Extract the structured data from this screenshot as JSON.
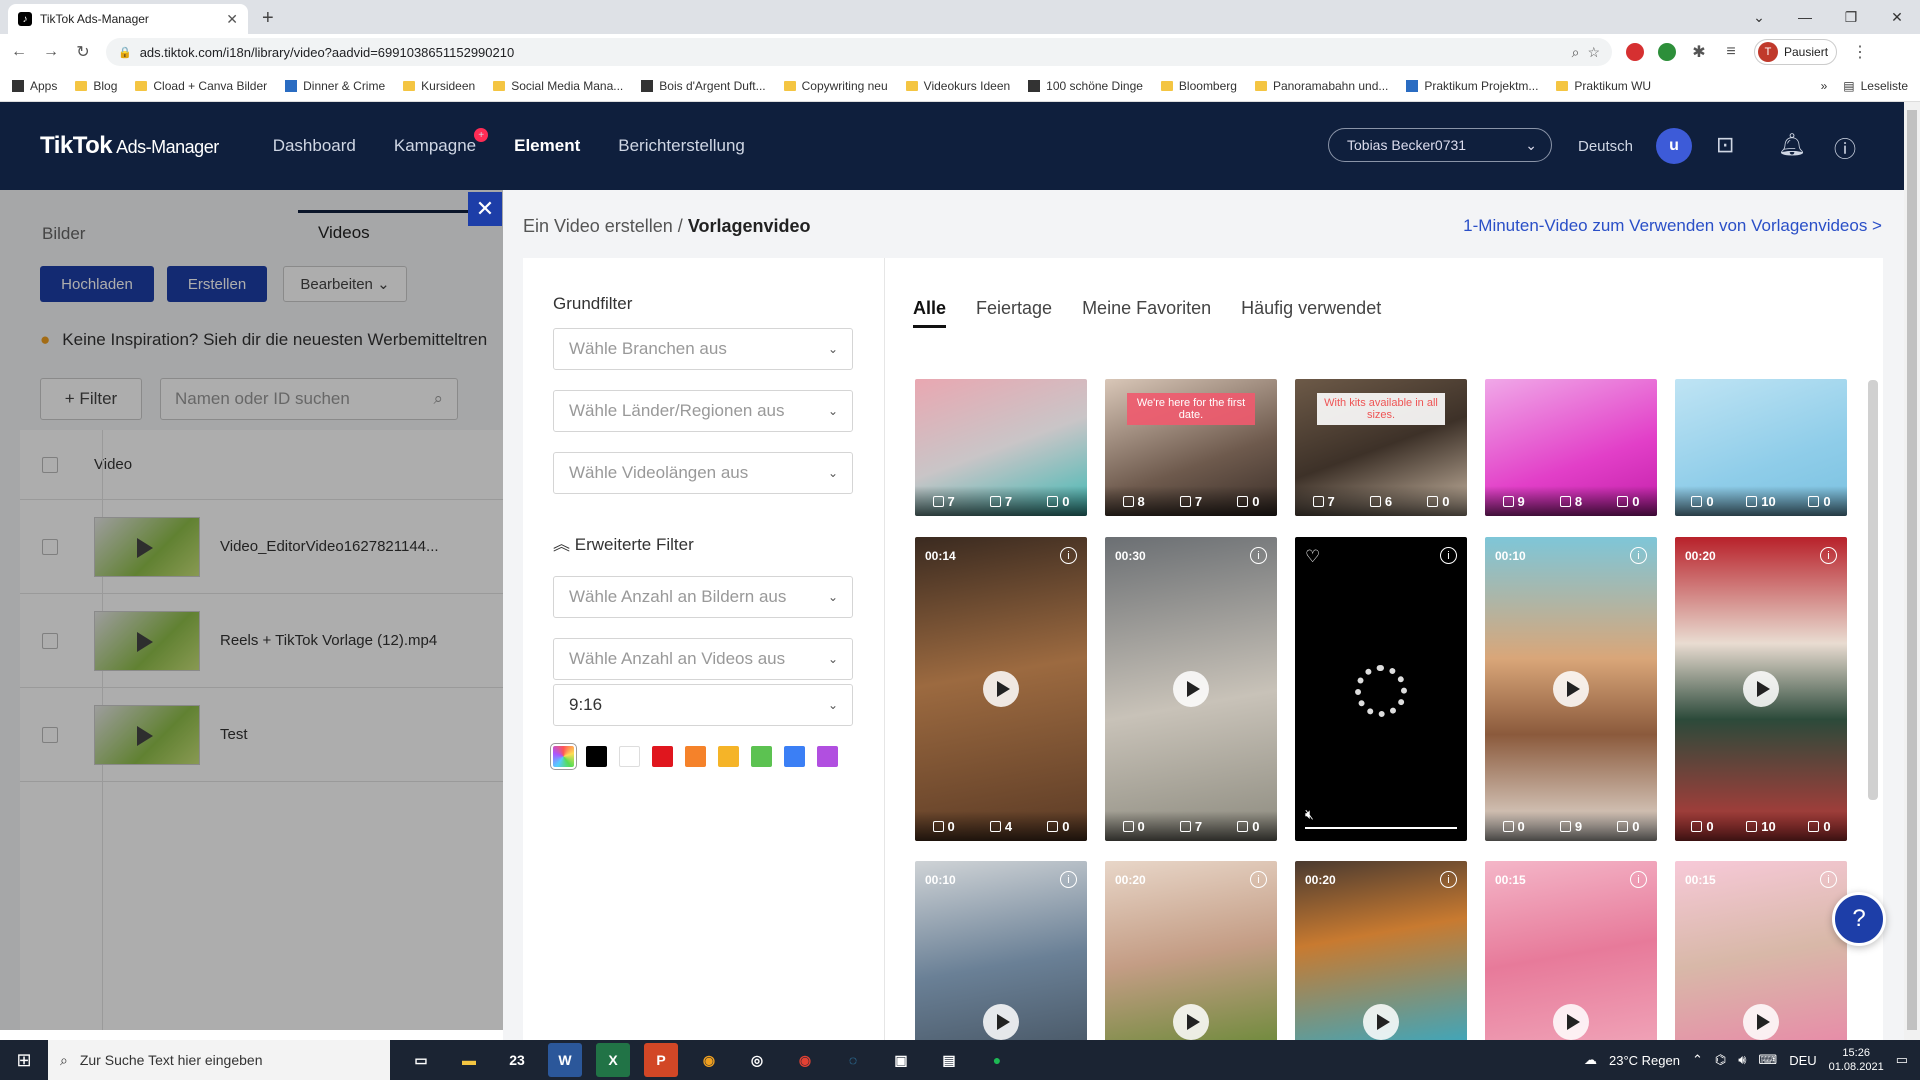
{
  "browser": {
    "tab_title": "TikTok Ads-Manager",
    "url": "ads.tiktok.com/i18n/library/video?aadvid=6991038651152990210",
    "profile_initial": "T",
    "profile_status": "Pausiert",
    "bookmarks": [
      "Apps",
      "Blog",
      "Cload + Canva Bilder",
      "Dinner & Crime",
      "Kursideen",
      "Social Media Mana...",
      "Bois d'Argent Duft...",
      "Copywriting neu",
      "Videokurs Ideen",
      "100 schöne Dinge",
      "Bloomberg",
      "Panoramabahn und...",
      "Praktikum Projektm...",
      "Praktikum WU"
    ],
    "reading_list": "Leseliste",
    "more": "»"
  },
  "header": {
    "logo": "TikTok",
    "logo_sub": "Ads-Manager",
    "nav": [
      "Dashboard",
      "Kampagne",
      "Element",
      "Berichterstellung"
    ],
    "account": "Tobias Becker0731",
    "language": "Deutsch",
    "avatar": "u"
  },
  "library": {
    "tabs": [
      "Bilder",
      "Videos"
    ],
    "buttons": [
      "Hochladen",
      "Erstellen",
      "Bearbeiten"
    ],
    "banner": "Keine Inspiration? Sieh dir die neuesten Werbemitteltren",
    "filter_label": "+ Filter",
    "search_placeholder": "Namen oder ID suchen",
    "column_video": "Video",
    "rows": [
      "Video_EditorVideo1627821144...",
      "Reels + TikTok Vorlage (12).mp4",
      "Test"
    ]
  },
  "modal": {
    "breadcrumb_parent": "Ein Video erstellen",
    "breadcrumb_sep": "/",
    "breadcrumb_current": "Vorlagenvideo",
    "help_link": "1-Minuten-Video zum Verwenden von Vorlagenvideos >",
    "filter_title": "Grundfilter",
    "selects": [
      "Wähle Branchen aus",
      "Wähle Länder/Regionen aus",
      "Wähle Videolängen aus"
    ],
    "advanced_title": "Erweiterte Filter",
    "advanced_selects": [
      "Wähle Anzahl an Bildern aus",
      "Wähle Anzahl an Videos aus"
    ],
    "ratio": "9:16",
    "swatch_colors": [
      "#000000",
      "#ffffff",
      "#e0161e",
      "#f5822a",
      "#f5b428",
      "#5cc251",
      "#3b7ff5",
      "#b14fe0"
    ],
    "tabs": [
      "Alle",
      "Feiertage",
      "Meine Favoriten",
      "Häufig verwendet"
    ]
  },
  "tiles": [
    {
      "dur": "",
      "a": "7",
      "b": "7",
      "c": "0",
      "caption": ""
    },
    {
      "dur": "",
      "a": "8",
      "b": "7",
      "c": "0",
      "caption": "We're here for the first date."
    },
    {
      "dur": "",
      "a": "7",
      "b": "6",
      "c": "0",
      "caption": "With kits available in all sizes."
    },
    {
      "dur": "",
      "a": "9",
      "b": "8",
      "c": "0",
      "caption": ""
    },
    {
      "dur": "",
      "a": "0",
      "b": "10",
      "c": "0",
      "caption": ""
    },
    {
      "dur": "00:14",
      "a": "0",
      "b": "4",
      "c": "0"
    },
    {
      "dur": "00:30",
      "a": "0",
      "b": "7",
      "c": "0"
    },
    {
      "dur": "",
      "a": "",
      "b": "",
      "c": ""
    },
    {
      "dur": "00:10",
      "a": "0",
      "b": "9",
      "c": "0"
    },
    {
      "dur": "00:20",
      "a": "0",
      "b": "10",
      "c": "0"
    },
    {
      "dur": "00:10"
    },
    {
      "dur": "00:20"
    },
    {
      "dur": "00:20"
    },
    {
      "dur": "00:15"
    },
    {
      "dur": "00:15"
    }
  ],
  "taskbar": {
    "search_placeholder": "Zur Suche Text hier eingeben",
    "weather": "23°C Regen",
    "lang": "DEU",
    "time": "15:26",
    "date": "01.08.2021",
    "badge": "23"
  }
}
